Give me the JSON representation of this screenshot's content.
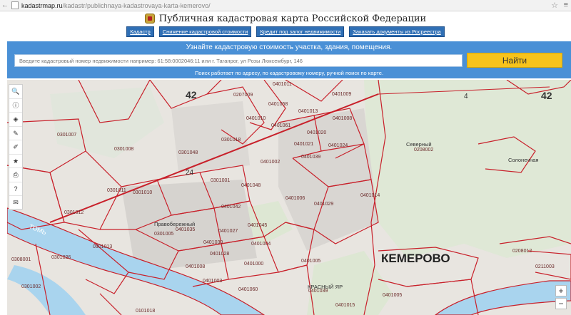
{
  "browser": {
    "url_domain": "kadastrmap.ru",
    "url_path": "/kadastr/publichnaya-kadastrovaya-karta-kemerovo/"
  },
  "header": {
    "title": "Публичная кадастровая карта Российской Федерации"
  },
  "nav": [
    {
      "label": "Кадастр"
    },
    {
      "label": "Снижение кадастровой стоимости"
    },
    {
      "label": "Кредит под залог недвижимости"
    },
    {
      "label": "Заказать документы из Росреестра"
    }
  ],
  "search": {
    "heading": "Узнайте кадастровую стоимость участка, здания, помещения.",
    "placeholder": "Введите кадастровый номер недвижимости например: 61:58:0002046:11 или г. Таганрог, ул Розы Люксембург, 146",
    "button": "Найти",
    "hint": "Поиск работает по адресу, по кадастровому номеру, ручной поиск по карте."
  },
  "map": {
    "city_label": "КЕМЕРОВО",
    "district_labels": [
      {
        "text": "Северный"
      },
      {
        "text": "Солонечная"
      },
      {
        "text": "КРАСНЫЙ ЯР"
      },
      {
        "text": "Правобережный"
      },
      {
        "text": "ТОМЬ"
      }
    ],
    "big_numbers": [
      "42",
      "42",
      "4",
      "24"
    ],
    "parcel_labels": [
      "0207009",
      "0401011",
      "0401009",
      "0401058",
      "0401013",
      "0401008",
      "0401061",
      "0401010",
      "0401020",
      "0401024",
      "0208002",
      "0401021",
      "0401039",
      "0301018",
      "0301008",
      "0301048",
      "0301007",
      "0301001",
      "0401002",
      "0401006",
      "0301011",
      "0301010",
      "0401048",
      "0401029",
      "0401014",
      "0301012",
      "0401042",
      "0401045",
      "0301005",
      "0401027",
      "0401035",
      "0301013",
      "0401030",
      "0401004",
      "0401003",
      "0401028",
      "0401008",
      "0401000",
      "0401060",
      "0401005",
      "0208012",
      "0211003",
      "0401015",
      "0301026",
      "0308001",
      "0301002",
      "0101018",
      "0401039",
      "0401005"
    ]
  },
  "toolbar": {
    "tools": [
      {
        "name": "search-tool-icon",
        "glyph": "🔍"
      },
      {
        "name": "info-tool-icon",
        "glyph": "ⓘ"
      },
      {
        "name": "layers-tool-icon",
        "glyph": "◈"
      },
      {
        "name": "draw-tool-icon",
        "glyph": "✎"
      },
      {
        "name": "measure-tool-icon",
        "glyph": "✐"
      },
      {
        "name": "favorite-tool-icon",
        "glyph": "★"
      },
      {
        "name": "print-tool-icon",
        "glyph": "⎙"
      },
      {
        "name": "help-tool-icon",
        "glyph": "?"
      },
      {
        "name": "mail-tool-icon",
        "glyph": "✉"
      }
    ]
  },
  "zoom": {
    "plus": "+",
    "minus": "−"
  },
  "colors": {
    "parcel_border": "#c8202a",
    "nav_button": "#2f6fb5",
    "search_panel": "#4a90d6",
    "find_button": "#f7c31b"
  }
}
